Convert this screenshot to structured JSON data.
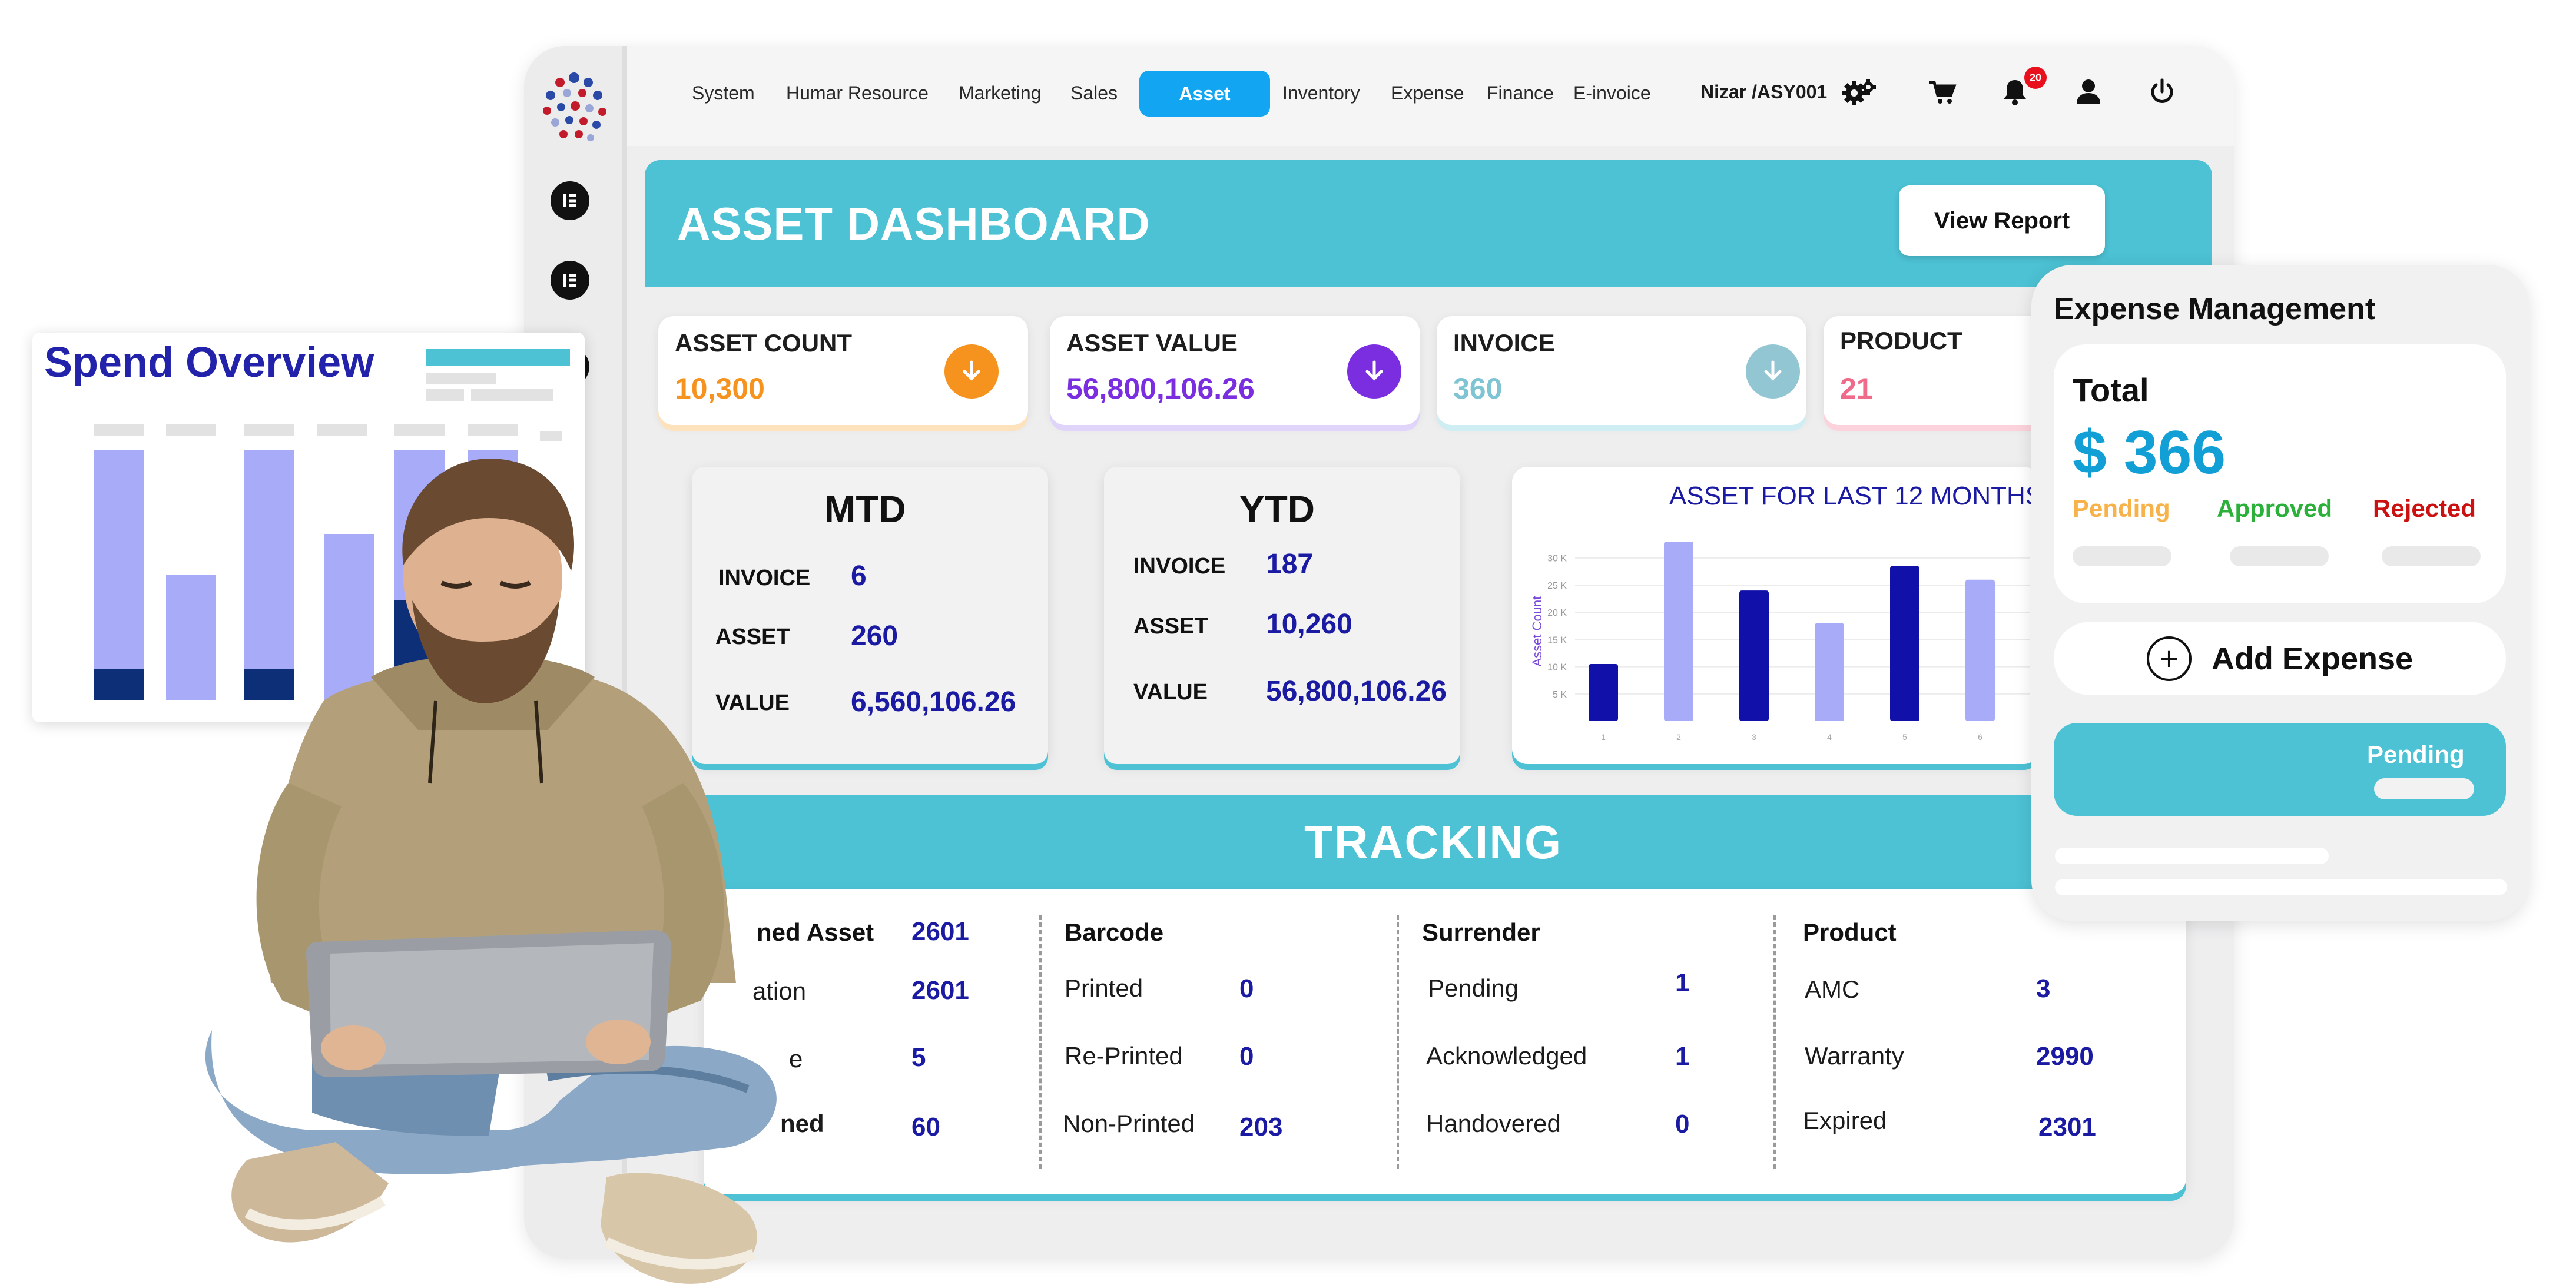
{
  "nav": {
    "items": [
      "System",
      "Humar Resource",
      "Marketing",
      "Sales",
      "Asset",
      "Inventory",
      "Expense",
      "Finance",
      "E-invoice"
    ],
    "active": "Asset",
    "user": "Nizar /ASY001",
    "notification_count": "20"
  },
  "dashboard": {
    "title": "ASSET DASHBOARD",
    "view_report": "View Report"
  },
  "kpis": [
    {
      "label": "ASSET COUNT",
      "value": "10,300",
      "color": "#f5931e"
    },
    {
      "label": "ASSET VALUE",
      "value": "56,800,106.26",
      "color": "#7a2ee0"
    },
    {
      "label": "INVOICE",
      "value": "360",
      "color": "#7ec4d3"
    },
    {
      "label": "PRODUCT",
      "value": "21",
      "color": "#f06a8a"
    }
  ],
  "mtd": {
    "title": "MTD",
    "rows": [
      {
        "label": "INVOICE",
        "value": "6"
      },
      {
        "label": "ASSET",
        "value": "260"
      },
      {
        "label": "VALUE",
        "value": "6,560,106.26"
      }
    ]
  },
  "ytd": {
    "title": "YTD",
    "rows": [
      {
        "label": "INVOICE",
        "value": "187"
      },
      {
        "label": "ASSET",
        "value": "10,260"
      },
      {
        "label": "VALUE",
        "value": "56,800,106.26"
      }
    ]
  },
  "chart_data": {
    "type": "bar",
    "title": "ASSET FOR LAST 12 MONTHS",
    "ylabel": "Asset Count",
    "xlabel": "",
    "categories": [
      "1",
      "2",
      "3",
      "4",
      "5",
      "6"
    ],
    "values": [
      10500,
      33000,
      24000,
      18000,
      28500,
      26000
    ],
    "bar_colors": [
      "#1111aa",
      "#a8acf8",
      "#1111aa",
      "#a8acf8",
      "#1111aa",
      "#a8acf8"
    ],
    "y_ticks": [
      "5 K",
      "10 K",
      "15 K",
      "20 K",
      "25 K",
      "30 K"
    ],
    "ylim": [
      0,
      33000
    ],
    "grid": true
  },
  "tracking": {
    "title": "TRACKING",
    "columns": [
      {
        "heading": "ned Asset",
        "value": "2601",
        "rows": [
          {
            "label": "ation",
            "value": "2601"
          },
          {
            "label": "e",
            "value": "5"
          },
          {
            "label": "ned",
            "value": "60"
          }
        ]
      },
      {
        "heading": "Barcode",
        "rows": [
          {
            "label": "Printed",
            "value": "0"
          },
          {
            "label": "Re-Printed",
            "value": "0"
          },
          {
            "label": "Non-Printed",
            "value": "203"
          }
        ]
      },
      {
        "heading": "Surrender",
        "rows": [
          {
            "label": "Pending",
            "value": "1"
          },
          {
            "label": "Acknowledged",
            "value": "1"
          },
          {
            "label": "Handovered",
            "value": "0"
          }
        ]
      },
      {
        "heading": "Product",
        "rows": [
          {
            "label": "AMC",
            "value": "3"
          },
          {
            "label": "Warranty",
            "value": "2990"
          },
          {
            "label": "Expired",
            "value": "2301"
          }
        ]
      }
    ]
  },
  "spend_overview": {
    "title": "Spend Overview"
  },
  "expense": {
    "title": "Expense Management",
    "total_label": "Total",
    "total_value": "$ 366",
    "statuses": [
      {
        "label": "Pending",
        "color": "#f7b34a"
      },
      {
        "label": "Approved",
        "color": "#2bb03a"
      },
      {
        "label": "Rejected",
        "color": "#cc1111"
      }
    ],
    "add_label": "Add Expense",
    "pending_label": "Pending"
  },
  "icons": {
    "rail": [
      "elementor-icon",
      "elementor-icon"
    ],
    "top": [
      "gear-icon",
      "cart-icon",
      "bell-icon",
      "user-icon",
      "power-icon"
    ]
  }
}
